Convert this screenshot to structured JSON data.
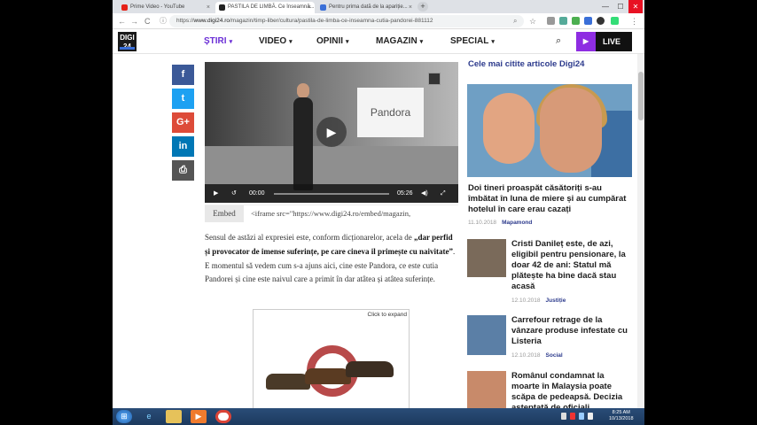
{
  "browser": {
    "tabs": [
      {
        "label": "Prime Video - YouTube",
        "favicon_color": "#e62117"
      },
      {
        "label": "PASTILA DE LIMBĂ. Ce înseamnă...",
        "favicon_color": "#222222"
      },
      {
        "label": "Pentru prima dată de la apariție...",
        "favicon_color": "#3a6fd8"
      }
    ],
    "new_tab": "+",
    "url_prefix": "https://",
    "url_host": "www.digi24.ro",
    "url_path": "/magazin/timp-liber/cultura/pastila-de-limba-ce-inseamna-cutia-pandorei-881112",
    "nav_back": "←",
    "nav_forward": "→",
    "nav_reload": "C",
    "info_icon": "ⓘ",
    "star": "☆",
    "win_min": "—",
    "win_max": "☐",
    "win_close": "✕"
  },
  "site": {
    "logo_text": "DIGI 24",
    "menu": [
      {
        "label": "ȘTIRI",
        "active": true
      },
      {
        "label": "VIDEO",
        "active": false
      },
      {
        "label": "OPINII",
        "active": false
      },
      {
        "label": "MAGAZIN",
        "active": false
      },
      {
        "label": "SPECIAL",
        "active": false
      }
    ],
    "caret": "▾",
    "live_label": "LIVE",
    "search_glyph": "⌕"
  },
  "share": [
    {
      "icon": "facebook-icon",
      "glyph": "f",
      "color": "#3b5998"
    },
    {
      "icon": "twitter-icon",
      "glyph": "t",
      "color": "#1da1f2"
    },
    {
      "icon": "google-plus-icon",
      "glyph": "G+",
      "color": "#dd4b39"
    },
    {
      "icon": "linkedin-icon",
      "glyph": "in",
      "color": "#0077b5"
    },
    {
      "icon": "print-icon",
      "glyph": "⎙",
      "color": "#555555"
    }
  ],
  "video": {
    "screen_text": "Pandora",
    "time_current": "00:00",
    "time_total": "05:26",
    "progress": 0
  },
  "embed": {
    "button_label": "Embed",
    "code": "<iframe src=\"https://www.digi24.ro/embed/magazin,"
  },
  "article": {
    "p1_a": "Sensul de astăzi al expresiei este, conform dicționarelor, acela de",
    "p1_bold": "„dar perfid și provocator de imense suferințe, pe care cineva il primește cu naivitate”",
    "p1_b": ". E momentul să vedem cum s-a ajuns aici, cine este Pandora, ce este cutia Pandorei și cine este naivul care a primit în dar atâtea și atâtea suferințe."
  },
  "ad": {
    "click_to_expand": "Click to expand"
  },
  "sidebar": {
    "title": "Cele mai citite articole Digi24",
    "featured": {
      "headline": "Doi tineri proaspăt căsătoriți s-au îmbătat în luna de miere și au cumpărat hotelul în care erau cazați",
      "date": "11.10.2018",
      "category": "Mapamond"
    },
    "items": [
      {
        "headline": "Cristi Danileț este, de azi, eligibil pentru pensionare, la doar 42 de ani: Statul mă plătește ha bine dacă stau acasă",
        "date": "12.10.2018",
        "category": "Justiție"
      },
      {
        "headline": "Carrefour retrage de la vânzare produse infestate cu Listeria",
        "date": "12.10.2018",
        "category": "Social"
      },
      {
        "headline": "Românul condamnat la moarte în Malaysia poate scăpa de pedeapsă. Decizia așteptată de oficiali",
        "date": "",
        "category": ""
      }
    ]
  },
  "taskbar": {
    "start": "⊞",
    "clock_time": "8:25 AM",
    "clock_date": "10/13/2018"
  }
}
